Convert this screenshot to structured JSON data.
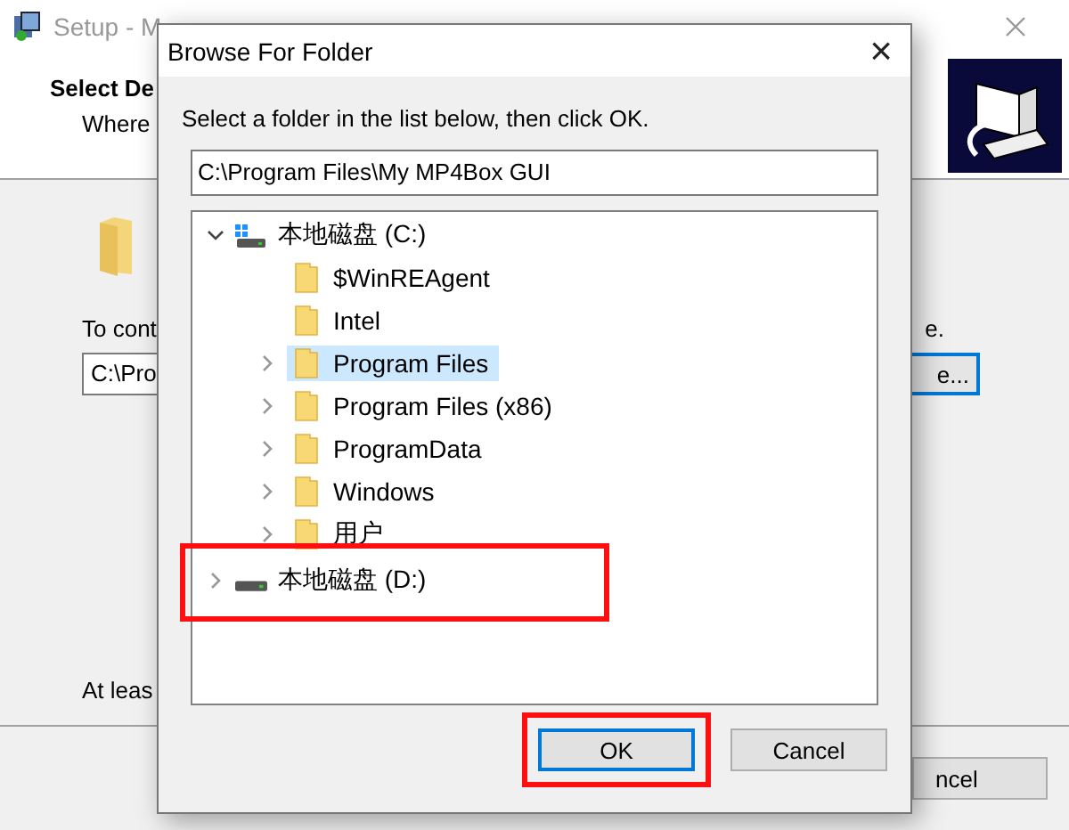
{
  "setup_window": {
    "title": "Setup - M",
    "heading": "Select De",
    "subheading": "Where",
    "instruction": "To cont",
    "instruction_end": "e.",
    "path_value": "C:\\Pro",
    "browse_button": "e...",
    "space_note": "At leas",
    "cancel_button": "ncel"
  },
  "dialog": {
    "title": "Browse For Folder",
    "close": "×",
    "instruction": "Select a folder in the list below, then click OK.",
    "path_value": "C:\\Program Files\\My MP4Box GUI",
    "tree": [
      {
        "label": "本地磁盘 (C:)",
        "kind": "drive",
        "expanded": true,
        "highlighted": false,
        "children": [
          {
            "label": "$WinREAgent",
            "kind": "folder",
            "expandable": false,
            "selected": false
          },
          {
            "label": "Intel",
            "kind": "folder",
            "expandable": false,
            "selected": false
          },
          {
            "label": "Program Files",
            "kind": "folder",
            "expandable": true,
            "selected": true
          },
          {
            "label": "Program Files (x86)",
            "kind": "folder",
            "expandable": true,
            "selected": false
          },
          {
            "label": "ProgramData",
            "kind": "folder",
            "expandable": true,
            "selected": false
          },
          {
            "label": "Windows",
            "kind": "folder",
            "expandable": true,
            "selected": false
          },
          {
            "label": "用户",
            "kind": "folder",
            "expandable": true,
            "selected": false
          }
        ]
      },
      {
        "label": "本地磁盘 (D:)",
        "kind": "drive",
        "expanded": false,
        "highlighted": true
      }
    ],
    "buttons": [
      {
        "label": "OK",
        "default": true,
        "highlighted": true
      },
      {
        "label": "Cancel",
        "default": false,
        "highlighted": false
      }
    ]
  }
}
